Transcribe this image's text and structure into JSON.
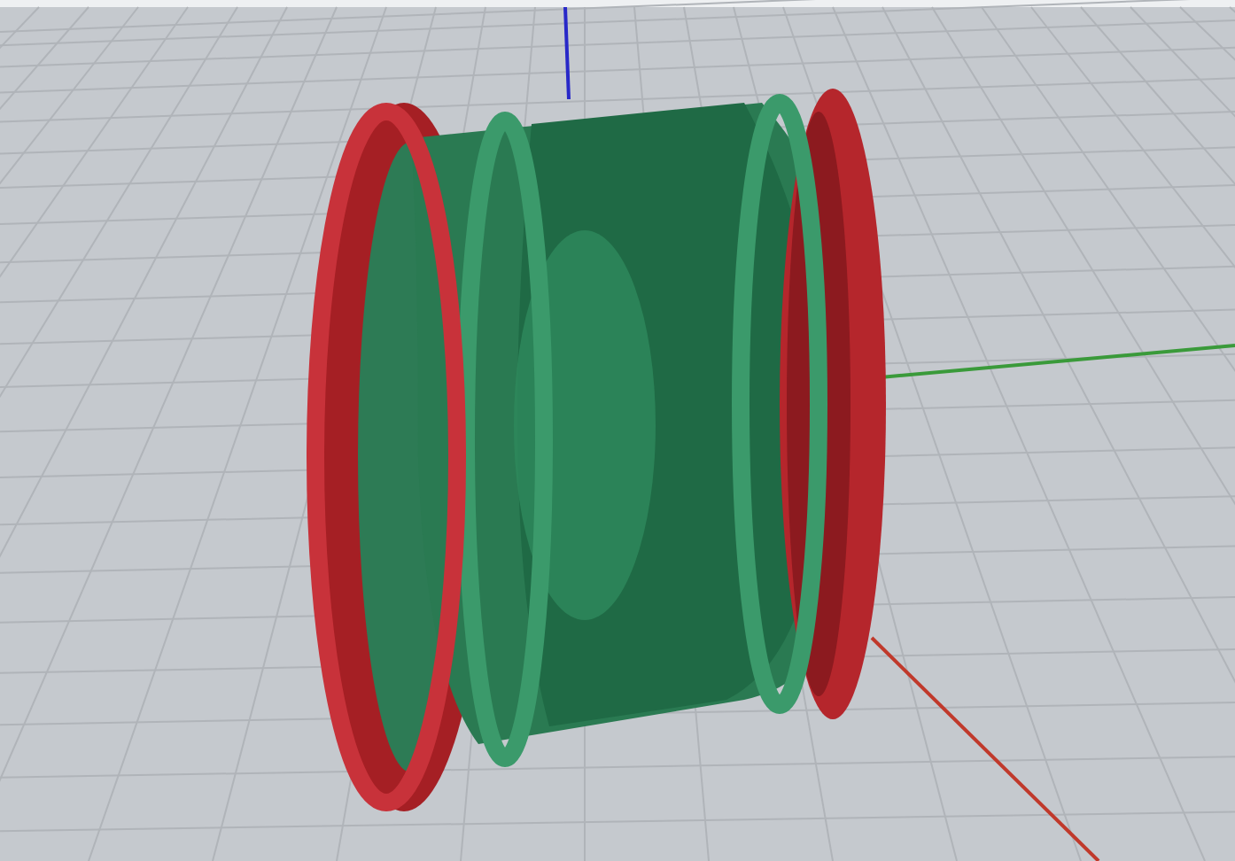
{
  "viewport": {
    "axes": [
      {
        "kind": "x",
        "color": "#c0392b"
      },
      {
        "kind": "y",
        "color": "#3a9a3a"
      },
      {
        "kind": "z",
        "color": "#2828c8"
      }
    ]
  }
}
